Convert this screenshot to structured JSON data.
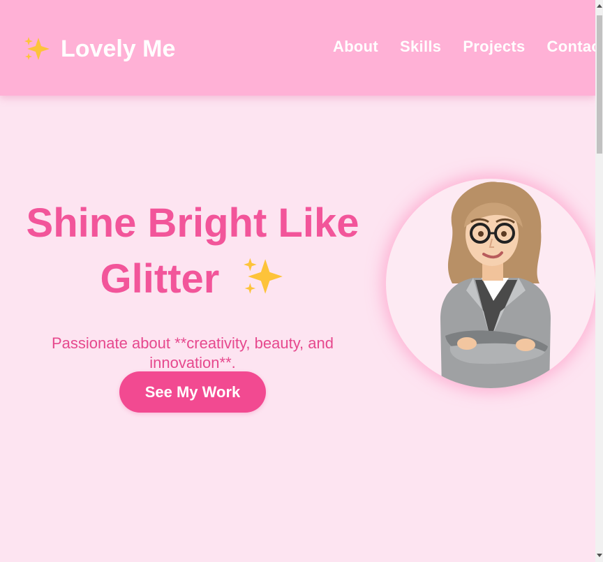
{
  "brand": {
    "icon": "sparkles-icon",
    "name": "Lovely Me"
  },
  "nav": {
    "items": [
      "About",
      "Skills",
      "Projects",
      "Contact"
    ]
  },
  "hero": {
    "title_line1": "Shine Bright Like",
    "title_line2": "Glitter",
    "title_icon": "sparkles-icon",
    "subtitle": "Passionate about **creativity, beauty, and innovation**.",
    "cta_label": "See My Work",
    "avatar": "cartoon-woman-avatar"
  },
  "colors": {
    "navbar": "#ffb1d6",
    "page_background": "#fde4f1",
    "accent": "#f2559a",
    "button": "#f24a91",
    "sparkle": "#fdc33a"
  }
}
